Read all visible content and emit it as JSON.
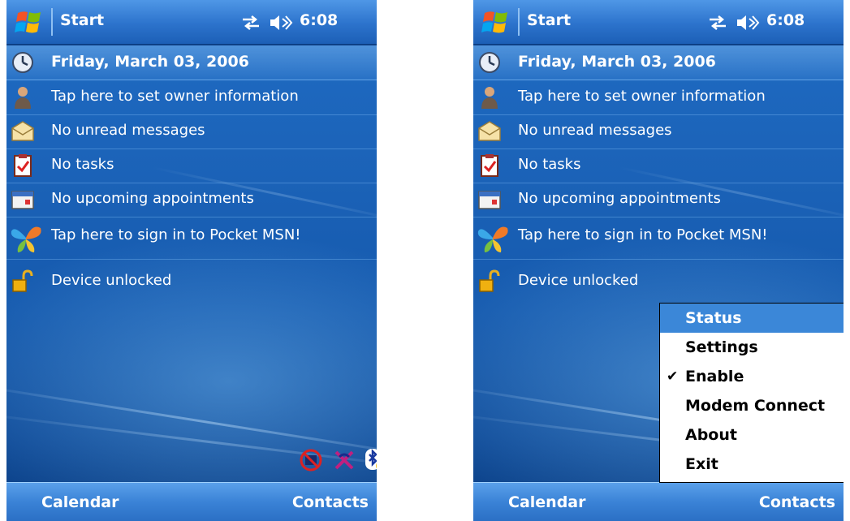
{
  "screens": [
    {
      "title": "Start",
      "time": "6:08",
      "date": "Friday, March 03, 2006",
      "items": [
        {
          "icon": "owner-icon",
          "label": "Tap here to set owner information"
        },
        {
          "icon": "messages-icon",
          "label": "No unread messages"
        },
        {
          "icon": "tasks-icon",
          "label": "No tasks"
        },
        {
          "icon": "calendar-icon",
          "label": "No upcoming appointments"
        },
        {
          "icon": "msn-butterfly-icon",
          "label": "Tap here to sign in to Pocket MSN!"
        },
        {
          "icon": "lock-icon",
          "label": "Device unlocked"
        }
      ],
      "tray_icons": [
        "connection-status-icon",
        "wireless-off-icon",
        "bluetooth-icon"
      ],
      "softkeys": {
        "left": "Calendar",
        "right": "Contacts"
      }
    },
    {
      "title": "Start",
      "time": "6:08",
      "date": "Friday, March 03, 2006",
      "items": [
        {
          "icon": "owner-icon",
          "label": "Tap here to set owner information"
        },
        {
          "icon": "messages-icon",
          "label": "No unread messages"
        },
        {
          "icon": "tasks-icon",
          "label": "No tasks"
        },
        {
          "icon": "calendar-icon",
          "label": "No upcoming appointments"
        },
        {
          "icon": "msn-butterfly-icon",
          "label": "Tap here to sign in to Pocket MSN!"
        },
        {
          "icon": "lock-icon",
          "label": "Device unlocked"
        }
      ],
      "softkeys": {
        "left": "Calendar",
        "right": "Contacts"
      },
      "context_menu": {
        "items": [
          {
            "label": "Status",
            "selected": true,
            "checked": false
          },
          {
            "label": "Settings",
            "selected": false,
            "checked": false
          },
          {
            "label": "Enable",
            "selected": false,
            "checked": true
          },
          {
            "label": "Modem Connect",
            "selected": false,
            "checked": false
          },
          {
            "label": "About",
            "selected": false,
            "checked": false
          },
          {
            "label": "Exit",
            "selected": false,
            "checked": false
          }
        ],
        "check_glyph": "✔"
      }
    }
  ],
  "colors": {
    "accent": "#3b87d8",
    "title_bar": "#2c73cc",
    "background": "#1b62b7"
  }
}
